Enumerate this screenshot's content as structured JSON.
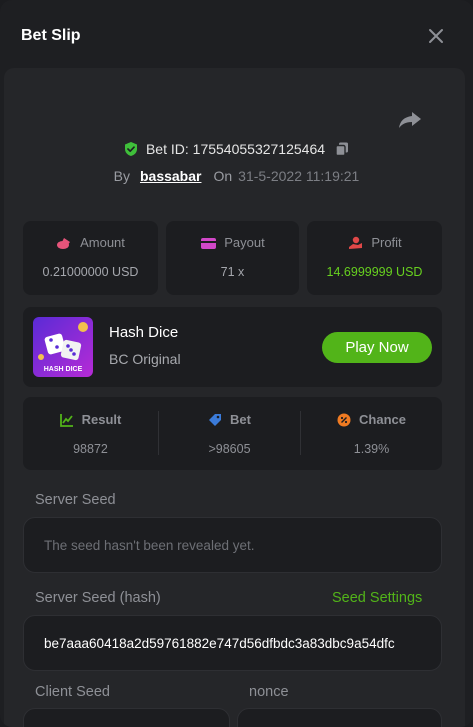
{
  "header": {
    "title": "Bet Slip",
    "close_icon": "close-icon"
  },
  "bet": {
    "id_text": "Bet ID: 17554055327125464",
    "by_label": "By",
    "user": "bassabar",
    "on_label": "On",
    "datetime": "31-5-2022 11:19:21"
  },
  "stats": {
    "amount": {
      "label": "Amount",
      "value": "0.21000000 USD",
      "icon": "coins-icon"
    },
    "payout": {
      "label": "Payout",
      "value": "71 x",
      "icon": "wallet-icon"
    },
    "profit": {
      "label": "Profit",
      "value": "14.6999999 USD",
      "icon": "hand-coin-icon"
    }
  },
  "game": {
    "name": "Hash Dice",
    "subtitle": "BC Original",
    "thumb_text": "HASH DICE",
    "play_label": "Play Now"
  },
  "result": {
    "result": {
      "label": "Result",
      "value": "98872"
    },
    "bet": {
      "label": "Bet",
      "value": ">98605"
    },
    "chance": {
      "label": "Chance",
      "value": "1.39%"
    }
  },
  "seeds": {
    "server_seed_label": "Server Seed",
    "server_seed_value": "The seed hasn't been revealed yet.",
    "server_hash_label": "Server Seed (hash)",
    "seed_settings_label": "Seed Settings",
    "server_hash_value": "be7aaa60418a2d59761882e747d56dfbdc3a83dbc9a54dfc",
    "client_seed_label": "Client Seed",
    "nonce_label": "nonce"
  },
  "colors": {
    "accent_green": "#52b419",
    "profit_green": "#67d11f",
    "background": "#1e1f22",
    "panel": "#252629",
    "card": "#1c1d20"
  }
}
